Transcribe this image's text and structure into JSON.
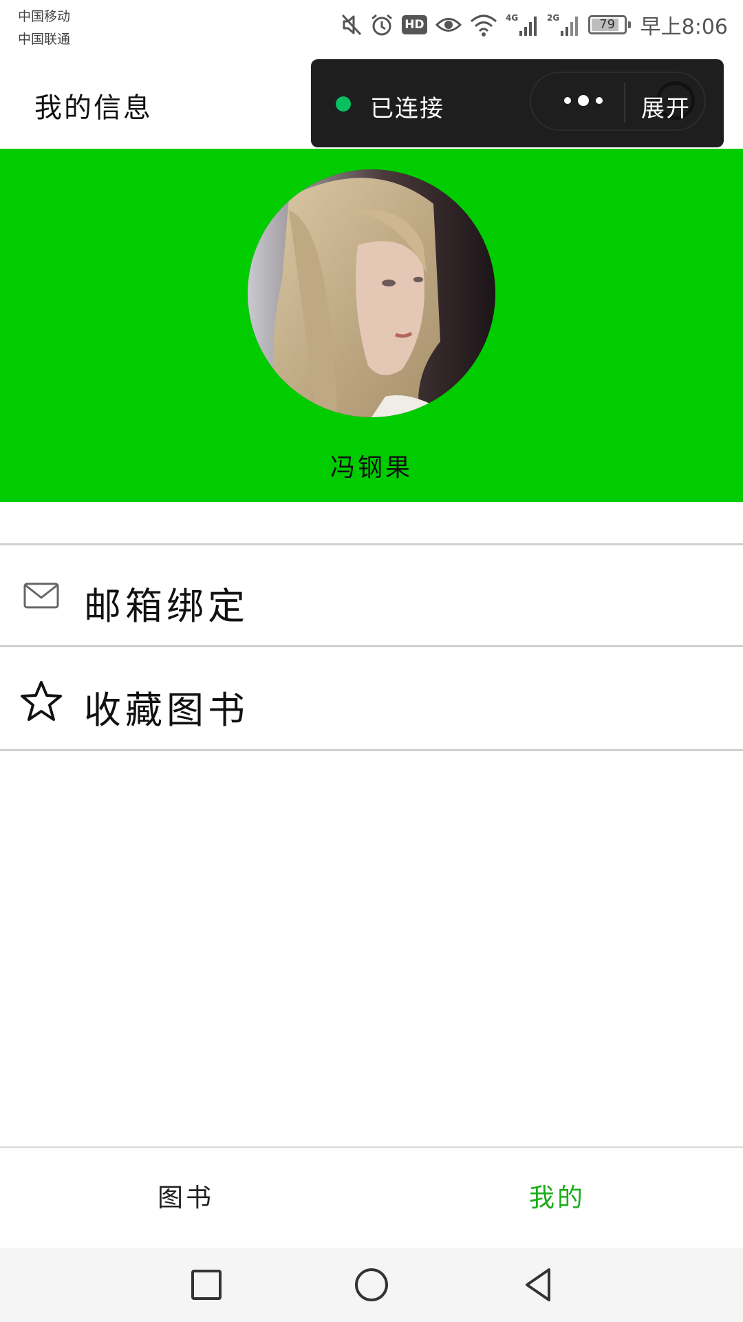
{
  "status_bar": {
    "carrier_1": "中国移动",
    "carrier_2": "中国联通",
    "hd_label": "HD",
    "network_1": "4G",
    "network_2": "2G",
    "battery_level": "79",
    "battery_fraction": 0.79,
    "time": "早上8:06",
    "icons": [
      "mute-icon",
      "alarm-icon",
      "hd-icon",
      "eye-icon",
      "wifi-icon",
      "signal-4g-icon",
      "signal-2g-icon",
      "battery-icon"
    ]
  },
  "header": {
    "title": "我的信息"
  },
  "capsule": {
    "status": "已连接",
    "status_color": "#07c160",
    "expand_label": "展开",
    "icons": [
      "status-dot-icon",
      "more-icon",
      "target-icon"
    ]
  },
  "profile": {
    "banner_color": "#00cc00",
    "name": "冯钢果",
    "avatar": "avatar-image"
  },
  "menu": {
    "items": [
      {
        "label": "邮箱绑定",
        "icon": "mail-icon"
      },
      {
        "label": "收藏图书",
        "icon": "star-icon"
      }
    ]
  },
  "tabbar": {
    "tabs": [
      {
        "label": "图书",
        "active": false
      },
      {
        "label": "我的",
        "active": true
      }
    ],
    "active_color": "#1aad19"
  },
  "nav": {
    "icons": [
      "recent-apps-icon",
      "home-icon",
      "back-icon"
    ]
  }
}
